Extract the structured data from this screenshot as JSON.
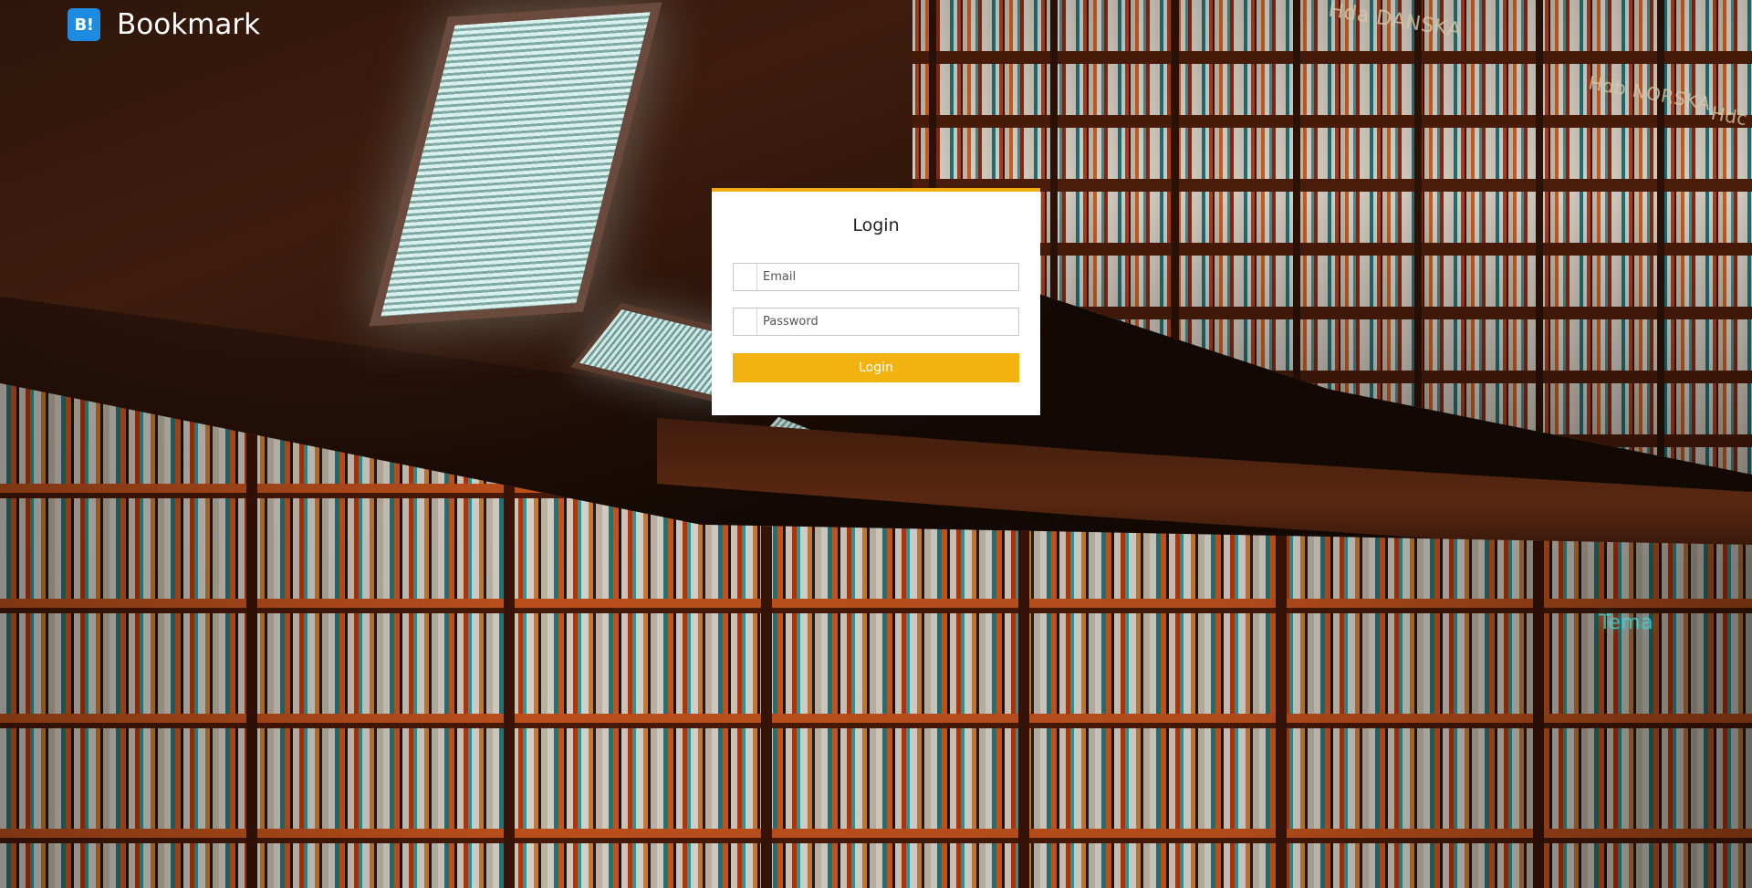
{
  "app": {
    "name": "Bookmark",
    "logo_text": "B!",
    "logo_color": "#1d8ce0"
  },
  "background": {
    "description_icon": "library-photo",
    "signs": [
      "Hda DANSKA",
      "Hdb NORSKA",
      "Hdc",
      "Tema"
    ]
  },
  "login": {
    "title": "Login",
    "accent_color": "#f2ad13",
    "email": {
      "placeholder": "Email",
      "value": "",
      "icon": "envelope-icon"
    },
    "password": {
      "placeholder": "Password",
      "value": "",
      "icon": "lock-icon"
    },
    "submit_label": "Login"
  }
}
